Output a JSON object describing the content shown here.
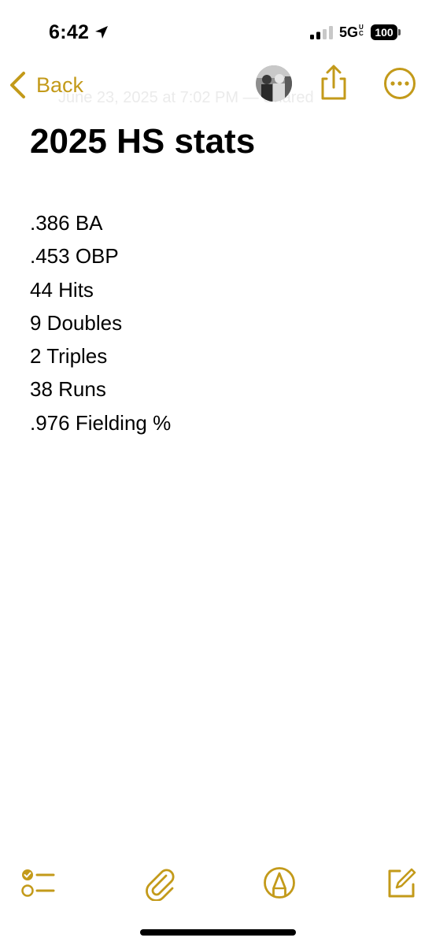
{
  "status": {
    "time": "6:42",
    "network": "5G",
    "network_sup": "UC",
    "battery": "100"
  },
  "nav": {
    "back_label": "Back",
    "faded_date": "June 23, 2025 at 7:02 PM — Shared"
  },
  "note": {
    "title": "2025 HS stats",
    "lines": [
      ".386 BA",
      ".453 OBP",
      "44 Hits",
      "9 Doubles",
      "2 Triples",
      "38 Runs",
      ".976 Fielding %"
    ]
  },
  "icons": {
    "accent": "#C39A1A",
    "back": "chevron-left-icon",
    "share": "share-icon",
    "more": "ellipsis-circle-icon",
    "checklist": "checklist-icon",
    "attach": "paperclip-icon",
    "markup": "pen-tip-circle-icon",
    "compose": "compose-icon"
  }
}
